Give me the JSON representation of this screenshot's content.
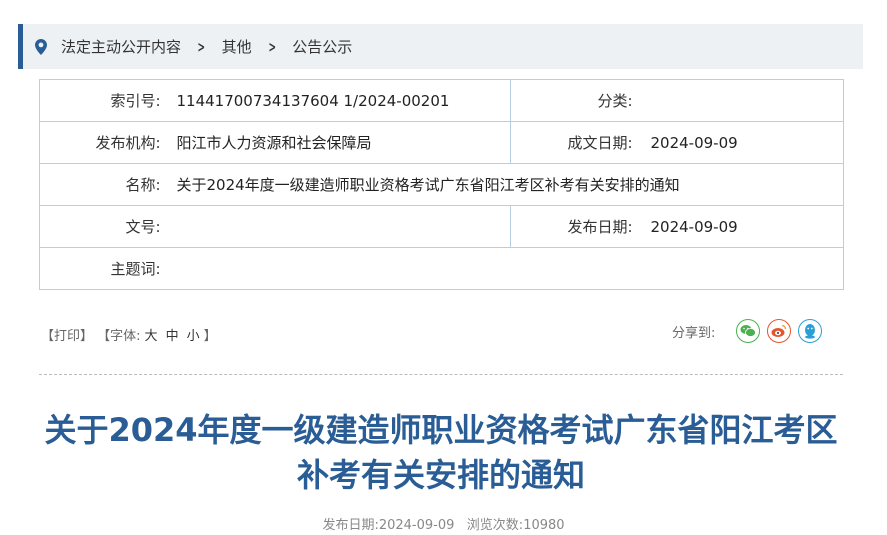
{
  "breadcrumb": {
    "items": [
      "法定主动公开内容",
      "其他",
      "公告公示"
    ]
  },
  "meta": {
    "index_label": "索引号:",
    "index_value": "11441700734137604 1/2024-00201",
    "category_label": "分类:",
    "category_value": "",
    "publisher_label": "发布机构:",
    "publisher_value": "阳江市人力资源和社会保障局",
    "created_label": "成文日期:",
    "created_value": "2024-09-09",
    "name_label": "名称:",
    "name_value": "关于2024年度一级建造师职业资格考试广东省阳江考区补考有关安排的通知",
    "docno_label": "文号:",
    "docno_value": "",
    "published_label": "发布日期:",
    "published_value": "2024-09-09",
    "keywords_label": "主题词:",
    "keywords_value": ""
  },
  "tools": {
    "print": "【打印】",
    "font_prefix": "【字体:",
    "font_large": "大",
    "font_medium": "中",
    "font_small": "小",
    "font_suffix": "】"
  },
  "share": {
    "label": "分享到:",
    "colors": {
      "wechat": "#4caf50",
      "weibo": "#e6532d",
      "qq": "#2a9fd6"
    }
  },
  "article": {
    "title": "关于2024年度一级建造师职业资格考试广东省阳江考区补考有关安排的通知",
    "pub_date_label": "发布日期:",
    "pub_date": "2024-09-09",
    "views_label": "浏览次数:",
    "views": "10980"
  }
}
